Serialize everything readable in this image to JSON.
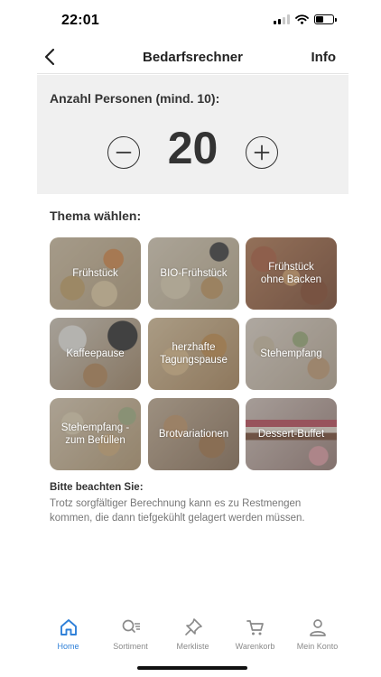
{
  "status_bar": {
    "time": "22:01"
  },
  "nav": {
    "title": "Bedarfsrechner",
    "info_label": "Info",
    "back_icon": "chevron-left-icon"
  },
  "persons": {
    "label": "Anzahl Personen (mind. 10):",
    "count": "20",
    "minimum": 10
  },
  "theme": {
    "heading": "Thema wählen:",
    "tiles": [
      {
        "label": "Frühstück",
        "icon": "photo-breakfast"
      },
      {
        "label": "BIO-Frühstück",
        "icon": "photo-organic-breakfast"
      },
      {
        "label": "Frühstück\nohne Backen",
        "icon": "photo-breakfast-no-baking"
      },
      {
        "label": "Kaffeepause",
        "icon": "photo-coffee-break"
      },
      {
        "label": "herzhafte\nTagungspause",
        "icon": "photo-savory-break"
      },
      {
        "label": "Stehempfang",
        "icon": "photo-standing-reception"
      },
      {
        "label": "Stehempfang -\nzum Befüllen",
        "icon": "photo-reception-to-fill"
      },
      {
        "label": "Brotvariationen",
        "icon": "photo-bread-variations"
      },
      {
        "label": "Dessert-Buffet",
        "icon": "photo-dessert-buffet"
      }
    ]
  },
  "notice": {
    "title": "Bitte beachten Sie:",
    "text": "Trotz sorgfältiger Berechnung kann es zu Restmengen kommen, die dann tiefgekühlt gelagert werden müssen."
  },
  "tab_bar": {
    "items": [
      {
        "label": "Home",
        "icon": "home-icon",
        "active": true
      },
      {
        "label": "Sortiment",
        "icon": "search-list-icon",
        "active": false
      },
      {
        "label": "Merkliste",
        "icon": "pin-icon",
        "active": false
      },
      {
        "label": "Warenkorb",
        "icon": "cart-icon",
        "active": false
      },
      {
        "label": "Mein Konto",
        "icon": "user-icon",
        "active": false
      }
    ]
  },
  "colors": {
    "accent": "#2f80d8",
    "panel": "#f0f0f0",
    "text": "#333333",
    "muted": "#8a8a8a"
  }
}
